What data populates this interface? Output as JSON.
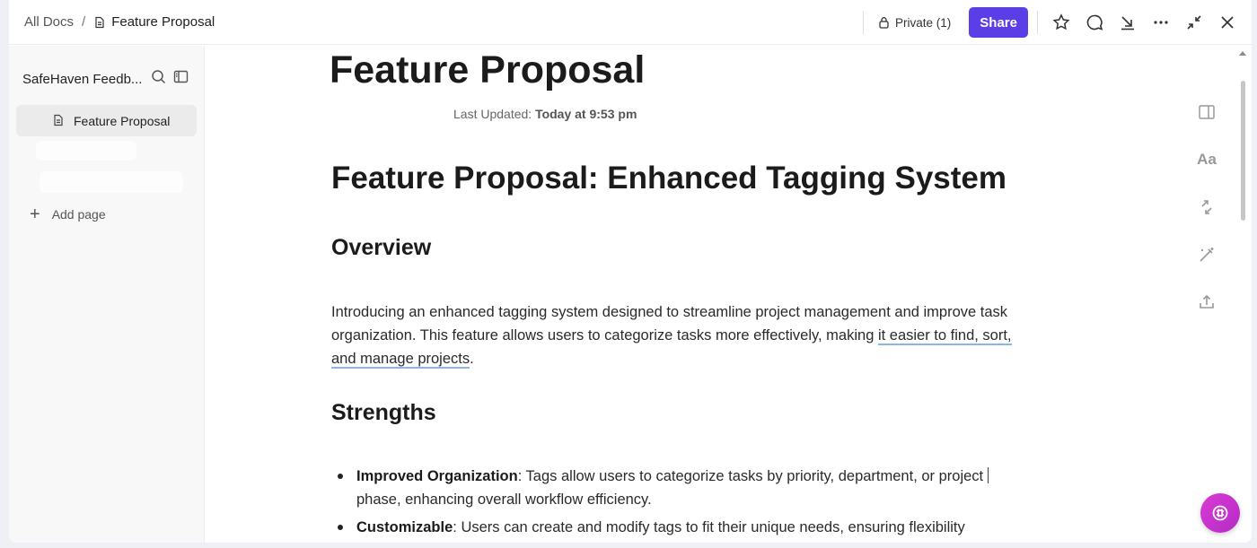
{
  "breadcrumb": {
    "root": "All Docs",
    "separator": "/",
    "current": "Feature Proposal"
  },
  "toolbar": {
    "private_label": "Private (1)",
    "share_label": "Share"
  },
  "sidebar": {
    "title": "SafeHaven Feedb...",
    "items": [
      {
        "label": "Feature Proposal"
      }
    ],
    "add_page": "Add page"
  },
  "doc": {
    "title": "Feature Proposal",
    "last_updated_label": "Last Updated:",
    "last_updated_value": "Today at 9:53 pm",
    "heading": "Feature Proposal: Enhanced Tagging System",
    "overview_heading": "Overview",
    "overview_text_1": "Introducing an enhanced tagging system designed to streamline project management and improve task organization. This feature allows users to categorize tasks more effectively, making ",
    "overview_text_link": "it easier to find, sort, and manage projects",
    "overview_text_2": ".",
    "strengths_heading": "Strengths",
    "strengths": [
      {
        "title": "Improved Organization",
        "text": ": Tags allow users to categorize tasks by priority, department, or project phase, enhancing overall workflow efficiency."
      },
      {
        "title": "Customizable",
        "text": ": Users can create and modify tags to fit their unique needs, ensuring flexibility"
      }
    ]
  },
  "rail": {
    "font_label": "Aa"
  },
  "colors": {
    "accent": "#5b3ee6",
    "fab": "#c935cc",
    "underline": "#8fb3ef"
  },
  "icons": [
    "document-icon",
    "lock-icon",
    "star-icon",
    "comment-icon",
    "download-icon",
    "more-icon",
    "collapse-icon",
    "close-icon",
    "search-icon",
    "sidebar-toggle-icon",
    "plus-icon",
    "panel-icon",
    "wand-icon",
    "export-icon",
    "ai-icon"
  ]
}
